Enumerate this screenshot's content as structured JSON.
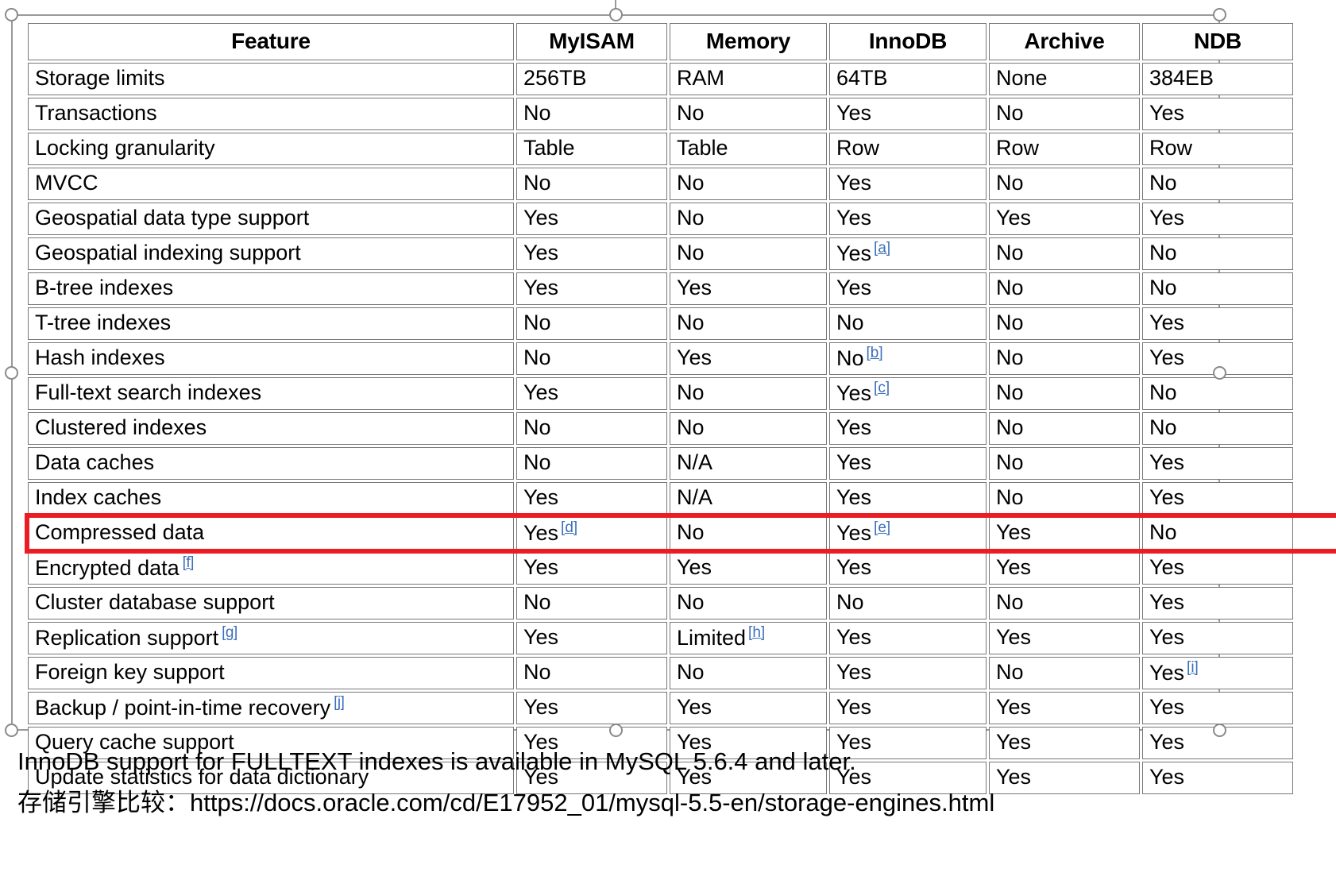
{
  "table": {
    "columns": [
      "Feature",
      "MyISAM",
      "Memory",
      "InnoDB",
      "Archive",
      "NDB"
    ],
    "rows": [
      {
        "feature": "Storage limits",
        "feature_fn": "",
        "cells": [
          {
            "v": "256TB",
            "fn": ""
          },
          {
            "v": "RAM",
            "fn": ""
          },
          {
            "v": "64TB",
            "fn": ""
          },
          {
            "v": "None",
            "fn": ""
          },
          {
            "v": "384EB",
            "fn": ""
          }
        ]
      },
      {
        "feature": "Transactions",
        "feature_fn": "",
        "cells": [
          {
            "v": "No",
            "fn": ""
          },
          {
            "v": "No",
            "fn": ""
          },
          {
            "v": "Yes",
            "fn": ""
          },
          {
            "v": "No",
            "fn": ""
          },
          {
            "v": "Yes",
            "fn": ""
          }
        ]
      },
      {
        "feature": "Locking granularity",
        "feature_fn": "",
        "cells": [
          {
            "v": "Table",
            "fn": ""
          },
          {
            "v": "Table",
            "fn": ""
          },
          {
            "v": "Row",
            "fn": ""
          },
          {
            "v": "Row",
            "fn": ""
          },
          {
            "v": "Row",
            "fn": ""
          }
        ]
      },
      {
        "feature": "MVCC",
        "feature_fn": "",
        "cells": [
          {
            "v": "No",
            "fn": ""
          },
          {
            "v": "No",
            "fn": ""
          },
          {
            "v": "Yes",
            "fn": ""
          },
          {
            "v": "No",
            "fn": ""
          },
          {
            "v": "No",
            "fn": ""
          }
        ]
      },
      {
        "feature": "Geospatial data type support",
        "feature_fn": "",
        "cells": [
          {
            "v": "Yes",
            "fn": ""
          },
          {
            "v": "No",
            "fn": ""
          },
          {
            "v": "Yes",
            "fn": ""
          },
          {
            "v": "Yes",
            "fn": ""
          },
          {
            "v": "Yes",
            "fn": ""
          }
        ]
      },
      {
        "feature": "Geospatial indexing support",
        "feature_fn": "",
        "cells": [
          {
            "v": "Yes",
            "fn": ""
          },
          {
            "v": "No",
            "fn": ""
          },
          {
            "v": "Yes",
            "fn": "[a]"
          },
          {
            "v": "No",
            "fn": ""
          },
          {
            "v": "No",
            "fn": ""
          }
        ]
      },
      {
        "feature": "B-tree indexes",
        "feature_fn": "",
        "cells": [
          {
            "v": "Yes",
            "fn": ""
          },
          {
            "v": "Yes",
            "fn": ""
          },
          {
            "v": "Yes",
            "fn": ""
          },
          {
            "v": "No",
            "fn": ""
          },
          {
            "v": "No",
            "fn": ""
          }
        ]
      },
      {
        "feature": "T-tree indexes",
        "feature_fn": "",
        "cells": [
          {
            "v": "No",
            "fn": ""
          },
          {
            "v": "No",
            "fn": ""
          },
          {
            "v": "No",
            "fn": ""
          },
          {
            "v": "No",
            "fn": ""
          },
          {
            "v": "Yes",
            "fn": ""
          }
        ]
      },
      {
        "feature": "Hash indexes",
        "feature_fn": "",
        "cells": [
          {
            "v": "No",
            "fn": ""
          },
          {
            "v": "Yes",
            "fn": ""
          },
          {
            "v": "No",
            "fn": "[b]"
          },
          {
            "v": "No",
            "fn": ""
          },
          {
            "v": "Yes",
            "fn": ""
          }
        ]
      },
      {
        "feature": "Full-text search indexes",
        "feature_fn": "",
        "cells": [
          {
            "v": "Yes",
            "fn": ""
          },
          {
            "v": "No",
            "fn": ""
          },
          {
            "v": "Yes",
            "fn": "[c]"
          },
          {
            "v": "No",
            "fn": ""
          },
          {
            "v": "No",
            "fn": ""
          }
        ]
      },
      {
        "feature": "Clustered indexes",
        "feature_fn": "",
        "cells": [
          {
            "v": "No",
            "fn": ""
          },
          {
            "v": "No",
            "fn": ""
          },
          {
            "v": "Yes",
            "fn": ""
          },
          {
            "v": "No",
            "fn": ""
          },
          {
            "v": "No",
            "fn": ""
          }
        ]
      },
      {
        "feature": "Data caches",
        "feature_fn": "",
        "cells": [
          {
            "v": "No",
            "fn": ""
          },
          {
            "v": "N/A",
            "fn": ""
          },
          {
            "v": "Yes",
            "fn": ""
          },
          {
            "v": "No",
            "fn": ""
          },
          {
            "v": "Yes",
            "fn": ""
          }
        ]
      },
      {
        "feature": "Index caches",
        "feature_fn": "",
        "cells": [
          {
            "v": "Yes",
            "fn": ""
          },
          {
            "v": "N/A",
            "fn": ""
          },
          {
            "v": "Yes",
            "fn": ""
          },
          {
            "v": "No",
            "fn": ""
          },
          {
            "v": "Yes",
            "fn": ""
          }
        ]
      },
      {
        "feature": "Compressed data",
        "feature_fn": "",
        "cells": [
          {
            "v": "Yes",
            "fn": "[d]"
          },
          {
            "v": "No",
            "fn": ""
          },
          {
            "v": "Yes",
            "fn": "[e]"
          },
          {
            "v": "Yes",
            "fn": ""
          },
          {
            "v": "No",
            "fn": ""
          }
        ]
      },
      {
        "feature": "Encrypted data",
        "feature_fn": "[f]",
        "cells": [
          {
            "v": "Yes",
            "fn": ""
          },
          {
            "v": "Yes",
            "fn": ""
          },
          {
            "v": "Yes",
            "fn": ""
          },
          {
            "v": "Yes",
            "fn": ""
          },
          {
            "v": "Yes",
            "fn": ""
          }
        ]
      },
      {
        "feature": "Cluster database support",
        "feature_fn": "",
        "cells": [
          {
            "v": "No",
            "fn": ""
          },
          {
            "v": "No",
            "fn": ""
          },
          {
            "v": "No",
            "fn": ""
          },
          {
            "v": "No",
            "fn": ""
          },
          {
            "v": "Yes",
            "fn": ""
          }
        ]
      },
      {
        "feature": "Replication support",
        "feature_fn": "[g]",
        "cells": [
          {
            "v": "Yes",
            "fn": ""
          },
          {
            "v": "Limited",
            "fn": "[h]"
          },
          {
            "v": "Yes",
            "fn": ""
          },
          {
            "v": "Yes",
            "fn": ""
          },
          {
            "v": "Yes",
            "fn": ""
          }
        ]
      },
      {
        "feature": "Foreign key support",
        "feature_fn": "",
        "cells": [
          {
            "v": "No",
            "fn": ""
          },
          {
            "v": "No",
            "fn": ""
          },
          {
            "v": "Yes",
            "fn": ""
          },
          {
            "v": "No",
            "fn": ""
          },
          {
            "v": "Yes",
            "fn": "[i]"
          }
        ]
      },
      {
        "feature": "Backup / point-in-time recovery",
        "feature_fn": "[j]",
        "cells": [
          {
            "v": "Yes",
            "fn": ""
          },
          {
            "v": "Yes",
            "fn": ""
          },
          {
            "v": "Yes",
            "fn": ""
          },
          {
            "v": "Yes",
            "fn": ""
          },
          {
            "v": "Yes",
            "fn": ""
          }
        ]
      },
      {
        "feature": "Query cache support",
        "feature_fn": "",
        "cells": [
          {
            "v": "Yes",
            "fn": ""
          },
          {
            "v": "Yes",
            "fn": ""
          },
          {
            "v": "Yes",
            "fn": ""
          },
          {
            "v": "Yes",
            "fn": ""
          },
          {
            "v": "Yes",
            "fn": ""
          }
        ]
      },
      {
        "feature": "Update statistics for data dictionary",
        "feature_fn": "",
        "cells": [
          {
            "v": "Yes",
            "fn": ""
          },
          {
            "v": "Yes",
            "fn": ""
          },
          {
            "v": "Yes",
            "fn": ""
          },
          {
            "v": "Yes",
            "fn": ""
          },
          {
            "v": "Yes",
            "fn": ""
          }
        ]
      }
    ]
  },
  "highlight": {
    "row_label": "Compressed data",
    "color": "#ec1c24"
  },
  "caption": {
    "line1": "InnoDB support for FULLTEXT indexes is available in MySQL 5.6.4 and later.",
    "line2": "存储引擎比较：https://docs.oracle.com/cd/E17952_01/mysql-5.5-en/storage-engines.html"
  },
  "footnote_link_color": "#3c6fba"
}
